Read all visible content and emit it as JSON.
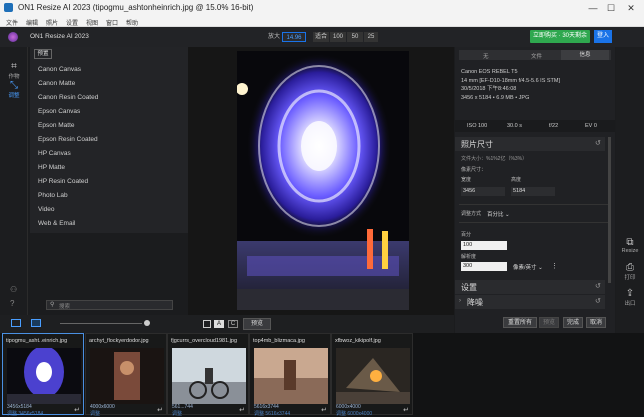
{
  "window": {
    "title": "ON1 Resize AI 2023 (tipogmu_ashtonheinrich.jpg @ 15.0% 16-bit)",
    "min": "—",
    "max": "☐",
    "close": "✕"
  },
  "menu": [
    "文件",
    "编辑",
    "照片",
    "设置",
    "视图",
    "窗口",
    "帮助"
  ],
  "app": {
    "name": "ON1 Resize AI 2023",
    "buy_label": "立即购买 · 30天剩余",
    "buy_color": "#2fa84f",
    "sign_label": "登入",
    "sign_color": "#1a73e8"
  },
  "zoom": {
    "label": "放大",
    "value": "14.96",
    "fit_label": "适合",
    "levels": [
      "100",
      "50",
      "25"
    ]
  },
  "left_rail": [
    {
      "icon": "crop-icon",
      "label": "作物"
    },
    {
      "icon": "resize-icon",
      "label": "调整"
    }
  ],
  "presets": {
    "tab": "预置",
    "items": [
      "Canon Canvas",
      "Canon Matte",
      "Canon Resin Coated",
      "Epson Canvas",
      "Epson Matte",
      "Epson Resin Coated",
      "HP Canvas",
      "HP Matte",
      "HP Resin Coated",
      "Photo Lab",
      "Video",
      "Web & Email"
    ]
  },
  "search": {
    "placeholder": "搜索"
  },
  "bottom": {
    "preview_label": "预览",
    "bg_white": "",
    "bg_a": "A",
    "bg_c": "C"
  },
  "info": {
    "tabs": [
      "无",
      "文件",
      "信息"
    ],
    "camera": "Canon EOS REBEL T5",
    "lens": "14 mm [EF-D10-18mm f/4.5-5.6 IS STM]",
    "date": "30/5/2018 下午8:46:08",
    "size": "3456 x 5184 • 6.9 MB • JPG",
    "iso": "ISO 100",
    "shutter": "30.0 s",
    "aperture": "f/22",
    "ev": "EV 0"
  },
  "pixel_size": {
    "title": "照片尺寸",
    "file_size": "文件大小：%1%2亿（%3%）",
    "doc_size": "像素尺寸：",
    "width_label": "宽度",
    "height_label": "高度",
    "width": "3456",
    "height": "5184",
    "adjust_label": "调整方式",
    "adjust_value": "百分比",
    "percent_label": "百分",
    "percent": "100",
    "res_label": "解析度",
    "res": "300",
    "res_unit": "像素/英寸"
  },
  "sections": [
    {
      "label": "设置"
    },
    {
      "label": "降噪"
    }
  ],
  "actions": {
    "reset": "重置所有",
    "prev": "预览",
    "done": "完成",
    "cancel": "取消"
  },
  "right_rail": [
    {
      "icon": "resize-tool-icon",
      "label": "Resize"
    },
    {
      "icon": "print-icon",
      "label": "打印"
    },
    {
      "icon": "export-icon",
      "label": "出口"
    }
  ],
  "filmstrip": [
    {
      "name": "tipogmu_asht..einrich.jpg",
      "dims": "3456x5184",
      "sub": "3456x5184",
      "tag": "调整",
      "selected": true
    },
    {
      "name": "archyt_flockyerdodor.jpg",
      "dims": "4000x6000",
      "sub": "",
      "tag": "调整",
      "selected": false
    },
    {
      "name": "fjgcurrs_overcloud1981.jpg",
      "dims": "561...744",
      "sub": "",
      "tag": "调整",
      "selected": false
    },
    {
      "name": "top4mb_blizmaca.jpg",
      "dims": "5616x3744",
      "sub": "5616x3744",
      "tag": "调整",
      "selected": false
    },
    {
      "name": "xfbwoz_kikipolf.jpg",
      "dims": "6000x4000",
      "sub": "6000x4000",
      "tag": "调整",
      "selected": false
    }
  ]
}
